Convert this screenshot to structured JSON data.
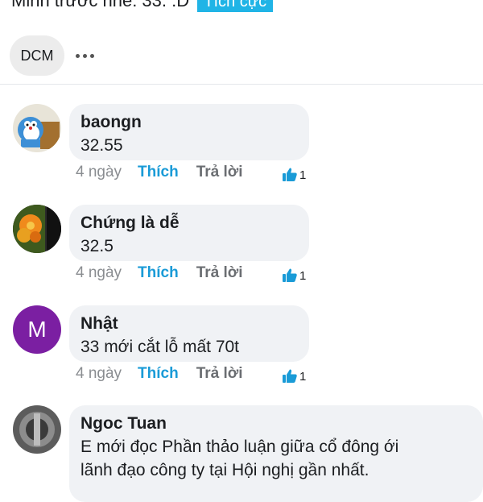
{
  "post": {
    "text": "Minh trước nhé: 33. :D",
    "sentiment_tag": "Tích cực",
    "sentiment_color": "#20b4e6"
  },
  "tags": [
    {
      "label": "DCM"
    }
  ],
  "icons": {
    "more": "more-horizontal-icon",
    "like": "thumbs-up-icon"
  },
  "accent_color": "#1a9bd7",
  "comments": [
    {
      "author": "baongn",
      "text": "32.55",
      "time": "4 ngày",
      "like_label": "Thích",
      "reply_label": "Trả lời",
      "like_count": "1",
      "avatar": "cartoon-avatar-image"
    },
    {
      "author": "Chứng là dễ",
      "text": "32.5",
      "time": "4 ngày",
      "like_label": "Thích",
      "reply_label": "Trả lời",
      "like_count": "1",
      "avatar": "orange-flower-avatar-image"
    },
    {
      "author": "Nhật",
      "text": "33 mới cắt lỗ mất 70t",
      "time": "4 ngày",
      "like_label": "Thích",
      "reply_label": "Trả lời",
      "like_count": "1",
      "avatar_letter": "M",
      "avatar_color": "#7b1fa2"
    },
    {
      "author": "Ngoc Tuan",
      "text_lines": [
        "E mới đọc Phần thảo luận giữa cổ đông ới",
        "lãnh đạo công ty tại Hội nghị gần nhất."
      ],
      "avatar": "gray-photo-avatar-image"
    }
  ]
}
